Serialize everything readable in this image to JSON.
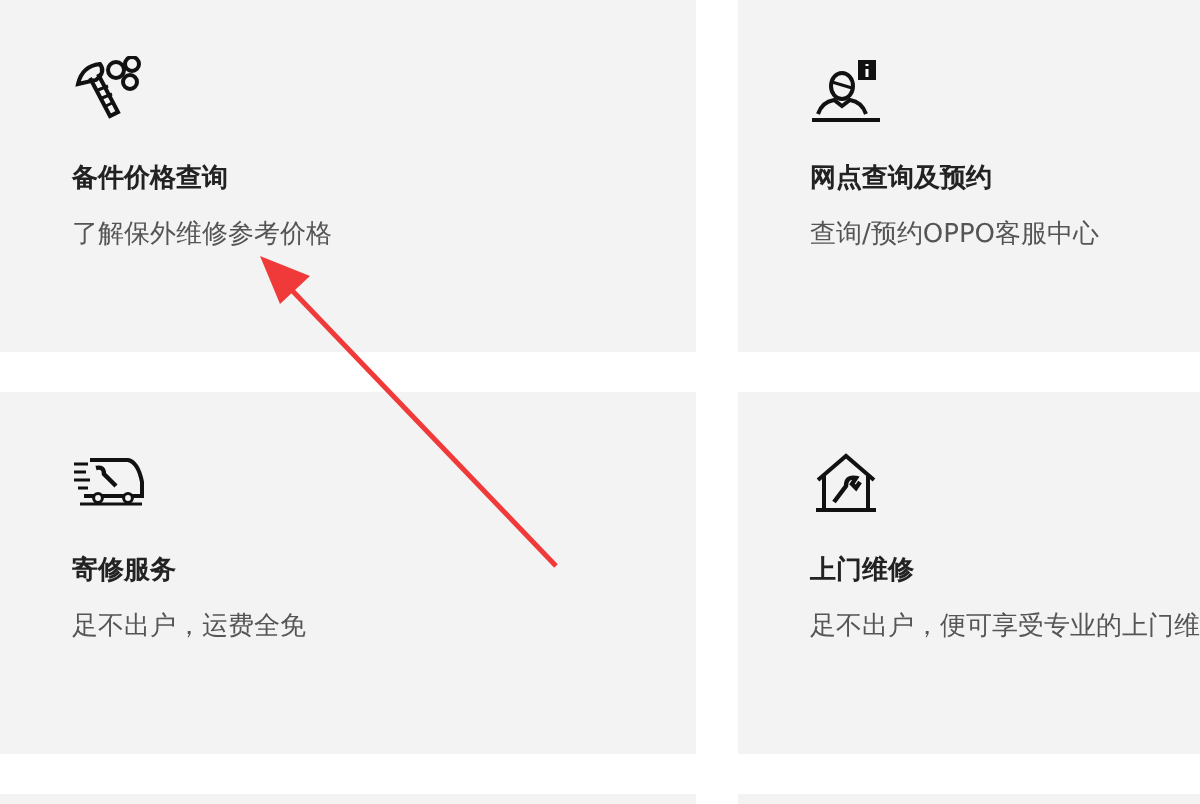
{
  "cards": [
    {
      "kind": "parts",
      "title": "备件价格查询",
      "description": "了解保外维修参考价格"
    },
    {
      "kind": "outlet",
      "title": "网点查询及预约",
      "description": "查询/预约OPPO客服中心"
    },
    {
      "kind": "mailin",
      "title": "寄修服务",
      "description": "足不出户，运费全免"
    },
    {
      "kind": "onsite",
      "title": "上门维修",
      "description": "足不出户，便可享受专业的上门维"
    }
  ]
}
